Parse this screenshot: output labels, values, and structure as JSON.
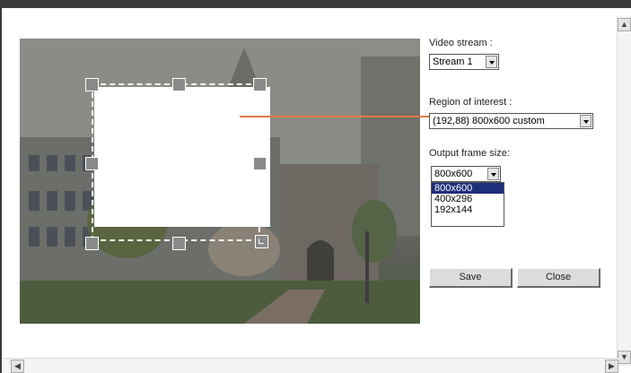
{
  "video_stream": {
    "label": "Video stream :",
    "value": "Stream 1"
  },
  "region_of_interest": {
    "label": "Region of interest :",
    "value": "(192,88) 800x600 custom"
  },
  "output_frame_size": {
    "label": "Output frame size:",
    "value": "800x600",
    "options": [
      "800x600",
      "400x296",
      "192x144"
    ],
    "selected_index": 0
  },
  "buttons": {
    "save": "Save",
    "close": "Close"
  },
  "colors": {
    "connector": "#e07a40",
    "selection": "#1d2f7a"
  }
}
